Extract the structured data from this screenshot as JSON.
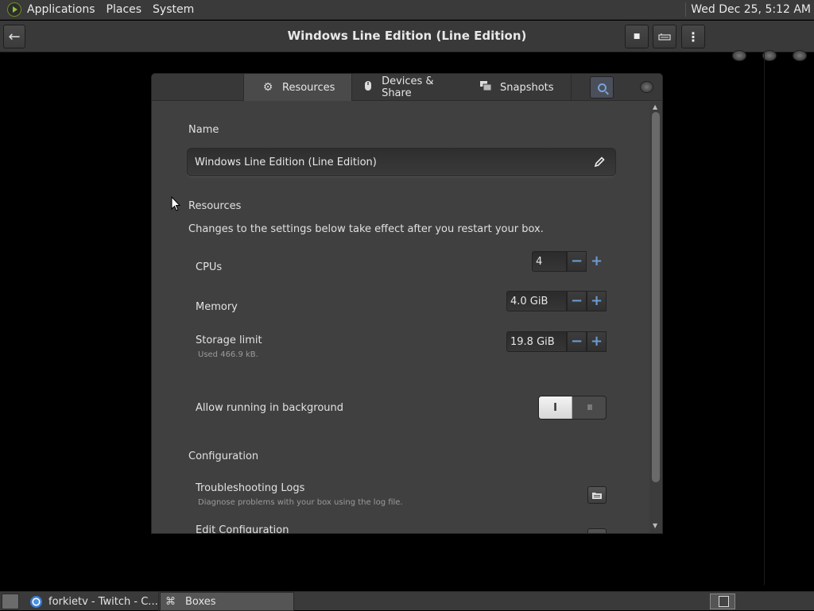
{
  "top_panel": {
    "menus": [
      "Applications",
      "Places",
      "System"
    ],
    "clock": "Wed Dec 25,  5:12 AM"
  },
  "header": {
    "title": "Windows Line Edition (Line Edition)",
    "back_glyph": "←",
    "stop_glyph": "■",
    "menu_glyph": "⋮"
  },
  "tabs": {
    "resources": "Resources",
    "devices": "Devices & Share",
    "snapshots": "Snapshots"
  },
  "name_section": {
    "label": "Name",
    "value": "Windows Line Edition (Line Edition)"
  },
  "resources": {
    "heading": "Resources",
    "note": "Changes to the settings below take effect after you restart your box.",
    "cpus": {
      "label": "CPUs",
      "value": "4"
    },
    "memory": {
      "label": "Memory",
      "value": "4.0 GiB"
    },
    "storage": {
      "label": "Storage limit",
      "used": "Used 466.9 kB.",
      "value": "19.8 GiB"
    },
    "spin_minus": "−",
    "spin_plus": "+",
    "background": {
      "label": "Allow running in background",
      "on_glyph": "I",
      "off_glyph": "III",
      "enabled": true
    }
  },
  "configuration": {
    "heading": "Configuration",
    "logs": {
      "label": "Troubleshooting Logs",
      "description": "Diagnose problems with your box using the log file."
    },
    "edit": {
      "label": "Edit Configuration"
    }
  },
  "taskbar": {
    "tasks": [
      "forkietv - Twitch - C...",
      "Boxes"
    ]
  },
  "colors": {
    "accent": "#6c9bd2",
    "panel": "#3a3a3a",
    "dialog": "#404040"
  }
}
